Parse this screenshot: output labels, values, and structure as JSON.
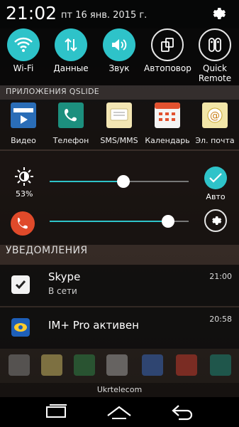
{
  "status_bar": {
    "time": "21:02",
    "date": "пт 16 янв. 2015 г."
  },
  "quick_settings": [
    {
      "label": "Wi-Fi",
      "icon": "wifi-icon",
      "state": "on"
    },
    {
      "label": "Данные",
      "icon": "data-arrows-icon",
      "state": "on"
    },
    {
      "label": "Звук",
      "icon": "speaker-icon",
      "state": "on"
    },
    {
      "label": "Автоповор",
      "icon": "rotate-icon",
      "state": "off"
    },
    {
      "label": "Quick\nRemote",
      "icon": "remote-icon",
      "state": "off"
    }
  ],
  "qslide": {
    "title": "ПРИЛОЖЕНИЯ QSLIDE",
    "apps": [
      {
        "label": "Видео",
        "icon": "video-clapper-icon",
        "color": "#2a6db7"
      },
      {
        "label": "Телефон",
        "icon": "phone-icon",
        "color": "#1c8f7e"
      },
      {
        "label": "SMS/MMS",
        "icon": "message-icon",
        "color": "#f3e6b4"
      },
      {
        "label": "Календарь",
        "icon": "calendar-icon",
        "color": "#f4f4f4"
      },
      {
        "label": "Эл. почта",
        "icon": "email-icon",
        "color": "#f2e6a8"
      }
    ]
  },
  "sliders": {
    "brightness_percent": "53%",
    "brightness_value": 0.53,
    "volume_value": 0.85,
    "auto_label": "Авто"
  },
  "notifications": {
    "title": "УВЕДОМЛЕНИЯ",
    "items": [
      {
        "title": "Skype",
        "subtitle": "В сети",
        "time": "21:00",
        "icon": "skype-icon"
      },
      {
        "title": "IM+ Pro активен",
        "subtitle": "",
        "time": "20:58",
        "icon": "improp-icon"
      }
    ]
  },
  "carrier": "Ukrtelecom",
  "colors": {
    "accent": "#2ec3c9"
  }
}
